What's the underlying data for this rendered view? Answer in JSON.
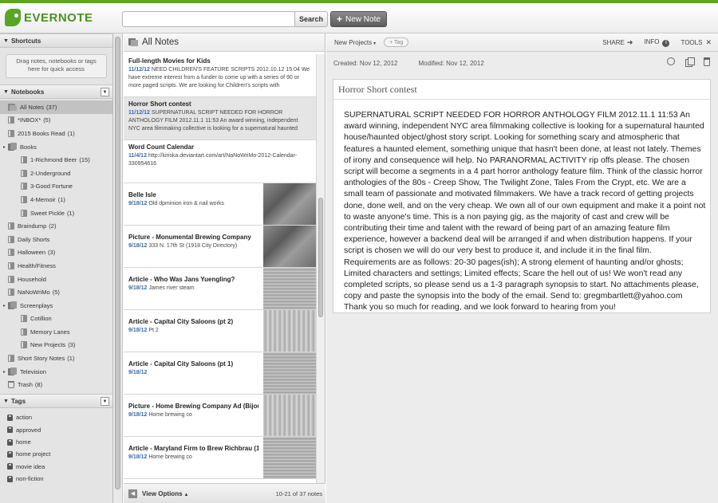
{
  "app": {
    "logo_text": "EVERNOTE",
    "search_placeholder": "",
    "search_button": "Search",
    "new_note_button": "New Note"
  },
  "sidebar": {
    "shortcuts_header": "Shortcuts",
    "shortcuts_hint": "Drag notes, notebooks or tags here for quick access",
    "notebooks_header": "Notebooks",
    "notebooks": [
      {
        "label": "All Notes",
        "count": "(37)",
        "type": "all",
        "indent": 0,
        "selected": true
      },
      {
        "label": "*INBOX*",
        "count": "(5)",
        "type": "nb",
        "indent": 0
      },
      {
        "label": "2015 Books Read",
        "count": "(1)",
        "type": "nb",
        "indent": 0
      },
      {
        "label": "Books",
        "count": "",
        "type": "stack",
        "indent": 0
      },
      {
        "label": "1-Richmond Beer",
        "count": "(15)",
        "type": "nb",
        "indent": 1
      },
      {
        "label": "2-Underground",
        "count": "",
        "type": "nb",
        "indent": 1
      },
      {
        "label": "3-Good Fortune",
        "count": "",
        "type": "nb",
        "indent": 1
      },
      {
        "label": "4-Memoir",
        "count": "(1)",
        "type": "nb",
        "indent": 1
      },
      {
        "label": "Sweet Pickle",
        "count": "(1)",
        "type": "nb",
        "indent": 1
      },
      {
        "label": "Braindump",
        "count": "(2)",
        "type": "nb",
        "indent": 0
      },
      {
        "label": "Daily Shorts",
        "count": "",
        "type": "nb",
        "indent": 0
      },
      {
        "label": "Halloween",
        "count": "(3)",
        "type": "nb",
        "indent": 0
      },
      {
        "label": "Health/Fitness",
        "count": "",
        "type": "nb",
        "indent": 0
      },
      {
        "label": "Household",
        "count": "",
        "type": "nb",
        "indent": 0
      },
      {
        "label": "NaNoWriMo",
        "count": "(5)",
        "type": "nb",
        "indent": 0
      },
      {
        "label": "Screenplays",
        "count": "",
        "type": "stack",
        "indent": 0
      },
      {
        "label": "Cotillion",
        "count": "",
        "type": "nb",
        "indent": 1
      },
      {
        "label": "Memory Lanes",
        "count": "",
        "type": "nb",
        "indent": 1
      },
      {
        "label": "New Projects",
        "count": "(3)",
        "type": "nb",
        "indent": 1
      },
      {
        "label": "Short Story Notes",
        "count": "(1)",
        "type": "nb",
        "indent": 0
      },
      {
        "label": "Television",
        "count": "",
        "type": "stack",
        "indent": 0
      },
      {
        "label": "Trash",
        "count": "(8)",
        "type": "trash",
        "indent": 0
      }
    ],
    "tags_header": "Tags",
    "tags": [
      "action",
      "approved",
      "home",
      "home project",
      "movie idea",
      "non-fiction"
    ]
  },
  "notelist": {
    "header": "All Notes",
    "view_options": "View Options",
    "count_text": "10-21 of 37 notes",
    "notes": [
      {
        "title": "Full-length Movies for Kids",
        "date": "11/12/12",
        "body": "NEED CHILDREN'S FEATURE SCRIPTS 2012.10.12 15:04 We have extreme interest from a funder to come up with a series of 90 or more paged scripts. We are looking for Children's scripts with",
        "thumb": false
      },
      {
        "title": "Horror Short contest",
        "date": "11/12/12",
        "body": "SUPERNATURAL SCRIPT NEEDED FOR HORROR ANTHOLOGY FILM 2012.11.1 11:53 An award winning, independent NYC area filmmaking collective is looking for a supernatural haunted",
        "thumb": false,
        "selected": true
      },
      {
        "title": "Word Count Calendar",
        "date": "11/4/12",
        "body": "http://kiriska.deviantart.com/art/NaNoWriMo-2012-Calendar-330954616",
        "thumb": false
      },
      {
        "title": "Belle Isle",
        "date": "9/18/12",
        "body": "Old dpminion iron & nail works",
        "thumb": true,
        "thumb_style": "dark"
      },
      {
        "title": "Picture - Monumental Brewing Company",
        "date": "9/18/12",
        "body": "333 N. 17th St (1918 City Directory)",
        "thumb": true,
        "thumb_style": "dark"
      },
      {
        "title": "Article - Who Was Jans Yuengling?",
        "date": "9/18/12",
        "body": "James river steam",
        "thumb": true,
        "thumb_style": "light"
      },
      {
        "title": "Article - Capital City Saloons (pt 2)",
        "date": "9/18/12",
        "body": "Pt 2",
        "thumb": true,
        "thumb_style": "paper"
      },
      {
        "title": "Article - Capital City Saloons (pt 1)",
        "date": "9/18/12",
        "body": "",
        "thumb": true,
        "thumb_style": "light"
      },
      {
        "title": "Picture - Home Brewing Company Ad (Bijou Ti",
        "date": "9/18/12",
        "body": "Home brewing co",
        "thumb": true,
        "thumb_style": "paper"
      },
      {
        "title": "Article - Maryland Firm to Brew Richbrau (196",
        "date": "9/18/12",
        "body": "Home brewing co",
        "thumb": true,
        "thumb_style": "light"
      }
    ]
  },
  "editor": {
    "notebook": "New Projects",
    "tag_placeholder": "+ Tag",
    "share": "SHARE",
    "info": "INFO",
    "tools": "TOOLS",
    "created": "Created: Nov 12, 2012",
    "modified": "Modified: Nov 12, 2012",
    "title": "Horror Short contest",
    "body": "SUPERNATURAL SCRIPT NEEDED FOR HORROR ANTHOLOGY FILM 2012.11.1 11:53 An award winning, independent NYC area filmmaking collective is looking for a supernatural haunted house/haunted object/ghost story script. Looking for something scary and atmospheric that features a haunted element, something unique that hasn't been done, at least not lately. Themes of irony and consequence will help. No PARANORMAL ACTIVITY rip offs please. The chosen script will become a segments in a 4 part horror anthology feature film. Think of the classic horror anthologies of the 80s - Creep Show, The Twilight Zone, Tales From the Crypt, etc. We are a small team of passionate and motivated filmmakers. We have a track record of getting projects done, done well, and on the very cheap. We own all of our own equipment and make it a point not to waste anyone's time. This is a non paying gig, as the majority of cast and crew will be contributing their time and talent with the reward of being part of an amazing feature film experience, however a backend deal will be arranged if and when distribution happens. If your script is chosen we will do our very best to produce it, and include it in the final film. Requirements are as follows: 20-30 pages(ish); A strong element of haunting and/or ghosts; Limited characters and settings; Limited effects; Scare the hell out of us! We won't read any completed scripts, so please send us a 1-3 paragraph synopsis to start. No attachments please, copy and paste the synopsis into the body of the email. Send to: gregmbartlett@yahoo.com Thank you so much for reading, and we look forward to hearing from you!"
  }
}
